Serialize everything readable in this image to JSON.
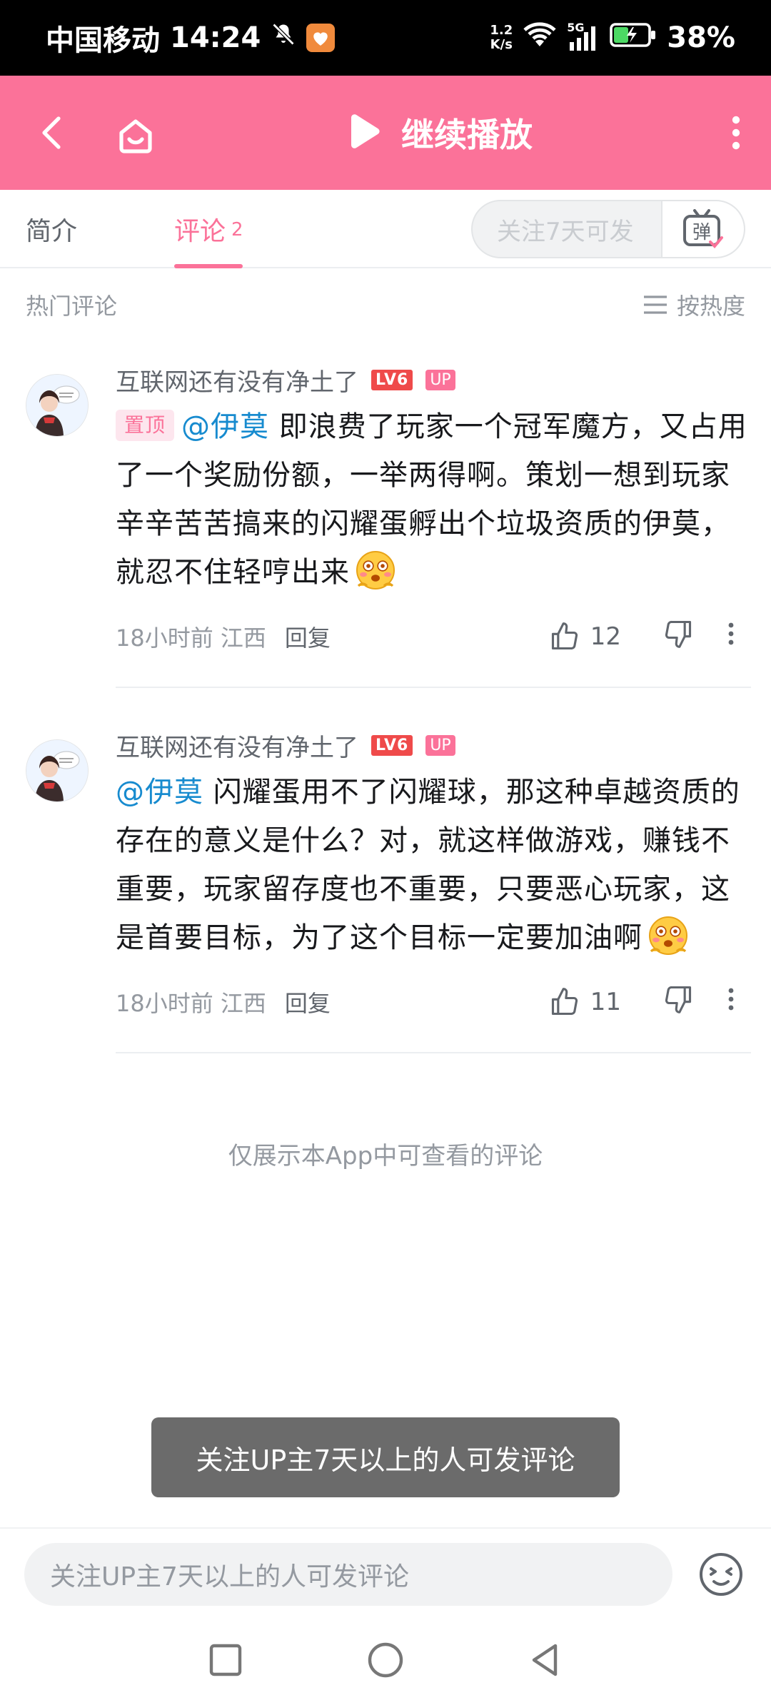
{
  "status_bar": {
    "carrier": "中国移动",
    "time": "14:24",
    "speed_top": "1.2",
    "speed_bottom": "K/s",
    "network": "5G",
    "battery": "38%"
  },
  "header": {
    "play_label": "继续播放",
    "icons": [
      "back-icon",
      "home-icon",
      "play-icon",
      "more-vertical-icon"
    ]
  },
  "tabs": {
    "intro": "简介",
    "comment": "评论",
    "comment_count": "2",
    "danmaku_placeholder": "关注7天可发",
    "danmaku_button": "弹"
  },
  "sort": {
    "title": "热门评论",
    "button": "按热度"
  },
  "comments": [
    {
      "username": "互联网还有没有净土了",
      "level": "LV6",
      "badge": "UP",
      "pinned_label": "置顶",
      "mention": "@伊莫",
      "text": " 即浪费了玩家一个冠军魔方，又占用了一个奖励份额，一举两得啊。策划一想到玩家辛辛苦苦搞来的闪耀蛋孵出个垃圾资质的伊莫，就忍不住轻哼出来",
      "time_location": "18小时前 江西",
      "reply_label": "回复",
      "likes": "12"
    },
    {
      "username": "互联网还有没有净土了",
      "level": "LV6",
      "badge": "UP",
      "mention": "@伊莫",
      "text": " 闪耀蛋用不了闪耀球，那这种卓越资质的存在的意义是什么？对，就这样做游戏，赚钱不重要，玩家留存度也不重要，只要恶心玩家，这是首要目标，为了这个目标一定要加油啊",
      "time_location": "18小时前 江西",
      "reply_label": "回复",
      "likes": "11"
    }
  ],
  "notice": "仅展示本App中可查看的评论",
  "toast": "关注UP主7天以上的人可发评论",
  "input": {
    "placeholder": "关注UP主7天以上的人可发评论"
  },
  "colors": {
    "brand_pink": "#fb7299",
    "mention_blue": "#178bcf",
    "level_red": "#ef4a4a"
  }
}
